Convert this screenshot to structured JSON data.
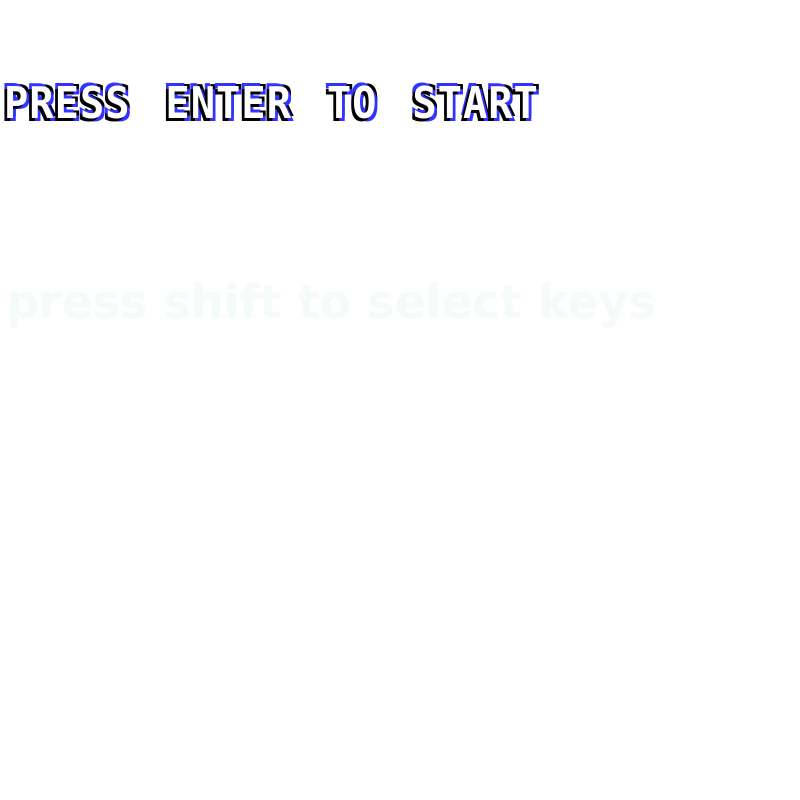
{
  "start_prompt": {
    "words": [
      "PRESS",
      "ENTER",
      "TO",
      "START"
    ]
  },
  "hint": {
    "text": "press shift to select keys"
  },
  "colors": {
    "background": "#ffffff",
    "pixel_text_fill": "#ffffff",
    "pixel_shadow_dark": "#000000",
    "pixel_shadow_blue": "#3333ff",
    "hint_text": "#f5fbf7"
  }
}
